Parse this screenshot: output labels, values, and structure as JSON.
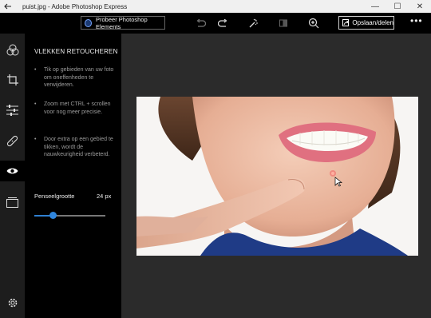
{
  "window": {
    "title": "puist.jpg - Adobe Photoshop Express",
    "back_icon": "back-arrow-icon",
    "minimize_glyph": "—",
    "maximize_glyph": "☐",
    "close_glyph": "✕"
  },
  "toolbar": {
    "promo_label": "Probeer Photoshop Elements",
    "share_label": "Opslaan/delen",
    "more_label": "•••",
    "icons": [
      "undo-icon",
      "redo-icon",
      "magic-wand-icon",
      "compare-icon",
      "zoom-in-icon"
    ]
  },
  "rail": {
    "items": [
      {
        "icon": "filters-icon",
        "active": false
      },
      {
        "icon": "crop-icon",
        "active": false
      },
      {
        "icon": "adjustments-icon",
        "active": false
      },
      {
        "icon": "bandage-icon",
        "active": false
      },
      {
        "icon": "eye-icon",
        "active": true
      },
      {
        "icon": "frame-icon",
        "active": false
      },
      {
        "icon": "settings-icon",
        "active": false
      }
    ]
  },
  "panel": {
    "title": "VLEKKEN RETOUCHEREN",
    "tips": [
      "Tik op gebieden van uw foto om oneffenheden te verwijderen.",
      "Zoom met CTRL + scrollen voor nog meer precisie.",
      "Door extra op een gebied te tikken, wordt de nauwkeurigheid verbeterd."
    ],
    "brush_label": "Penseelgrootte",
    "brush_value": "24 px",
    "brush_fraction": 0.26
  },
  "colors": {
    "accent": "#2f86de",
    "rail_bg": "#1d1d1d",
    "canvas_bg": "#2b2b2b",
    "titlebar_bg": "#f0f0f0"
  }
}
